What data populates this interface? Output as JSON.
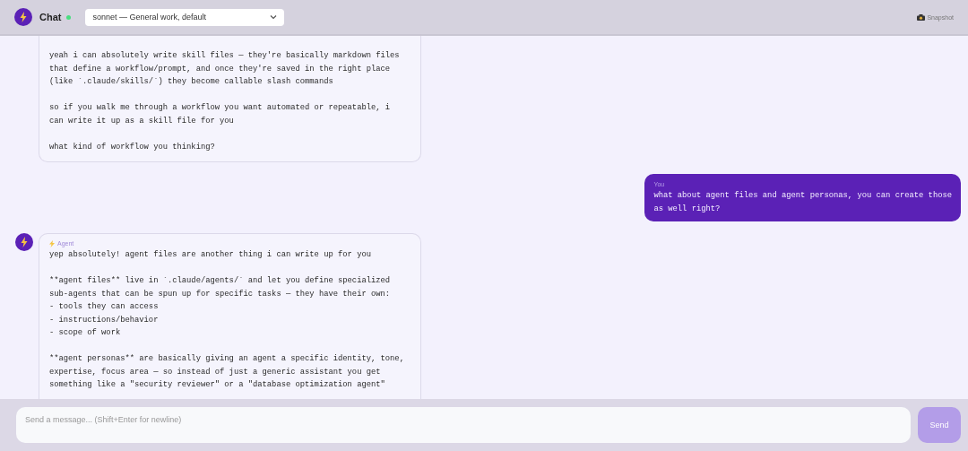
{
  "header": {
    "title": "Chat",
    "online": true,
    "model_select": {
      "value": "sonnet — General work, default"
    },
    "snapshot_button": "Snapshot"
  },
  "messages": [
    {
      "kind": "agent",
      "text": "yeah i can absolutely write skill files — they're basically markdown files\nthat define a workflow/prompt, and once they're saved in the right place\n(like `.claude/skills/`) they become callable slash commands\n\nso if you walk me through a workflow you want automated or repeatable, i\ncan write it up as a skill file for you\n\nwhat kind of workflow you thinking?"
    },
    {
      "kind": "user",
      "label": "You",
      "text": "what about agent files and agent personas, you can create those\nas well right?"
    },
    {
      "kind": "agent",
      "label": "Agent",
      "text": "yep absolutely! agent files are another thing i can write up for you\n\n**agent files** live in `.claude/agents/` and let you define specialized\nsub-agents that can be spun up for specific tasks — they have their own:\n- tools they can access\n- instructions/behavior\n- scope of work\n\n**agent personas** are basically giving an agent a specific identity, tone,\nexpertise, focus area — so instead of just a generic assistant you get\nsomething like a \"security reviewer\" or a \"database optimization agent\""
    }
  ],
  "composer": {
    "placeholder": "Send a message... (Shift+Enter for newline)",
    "send_button": {
      "label": "Send",
      "disabled": true
    }
  }
}
